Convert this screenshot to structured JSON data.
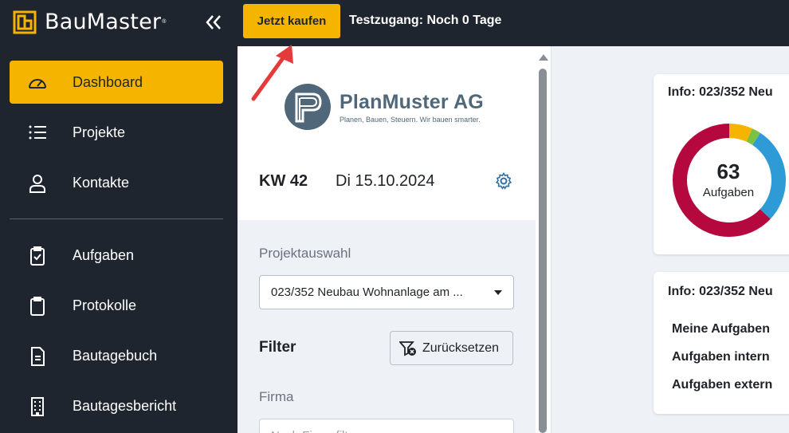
{
  "app": {
    "name": "BauMaster",
    "trademark": "®",
    "buy_label": "Jetzt kaufen",
    "trial_status": "Testzugang: Noch 0 Tage"
  },
  "sidebar": {
    "items": [
      {
        "label": "Dashboard",
        "icon": "speedometer-icon",
        "active": true
      },
      {
        "label": "Projekte",
        "icon": "list-icon"
      },
      {
        "label": "Kontakte",
        "icon": "person-icon"
      },
      {
        "label": "Aufgaben",
        "icon": "clipboard-check-icon"
      },
      {
        "label": "Protokolle",
        "icon": "clipboard-icon"
      },
      {
        "label": "Bautagebuch",
        "icon": "document-icon"
      },
      {
        "label": "Bautagesbericht",
        "icon": "building-icon"
      }
    ]
  },
  "company": {
    "name": "PlanMuster AG",
    "slogan": "Planen, Bauen, Steuern. Wir bauen smarter."
  },
  "header": {
    "week": "KW 42",
    "date": "Di 15.10.2024"
  },
  "filters": {
    "project_label": "Projektauswahl",
    "project_value": "023/352 Neubau Wohnanlage am ...",
    "filter_title": "Filter",
    "reset_label": "Zurücksetzen",
    "firma_label": "Firma",
    "firma_placeholder": "Nach Firma filtern"
  },
  "cards": {
    "card1_title": "Info: 023/352 Neu",
    "card2_title": "Info: 023/352 Neu",
    "donut_value": "63",
    "donut_label": "Aufgaben",
    "task_rows": [
      "Meine Aufgaben",
      "Aufgaben intern",
      "Aufgaben extern"
    ]
  },
  "colors": {
    "accent": "#f4b400",
    "sidebar_bg": "#1f252e",
    "donut_red": "#b5083f",
    "donut_blue": "#2e9ad6",
    "donut_yellow": "#f4b400",
    "donut_green": "#7cc242",
    "arrow": "#e63a3a"
  }
}
